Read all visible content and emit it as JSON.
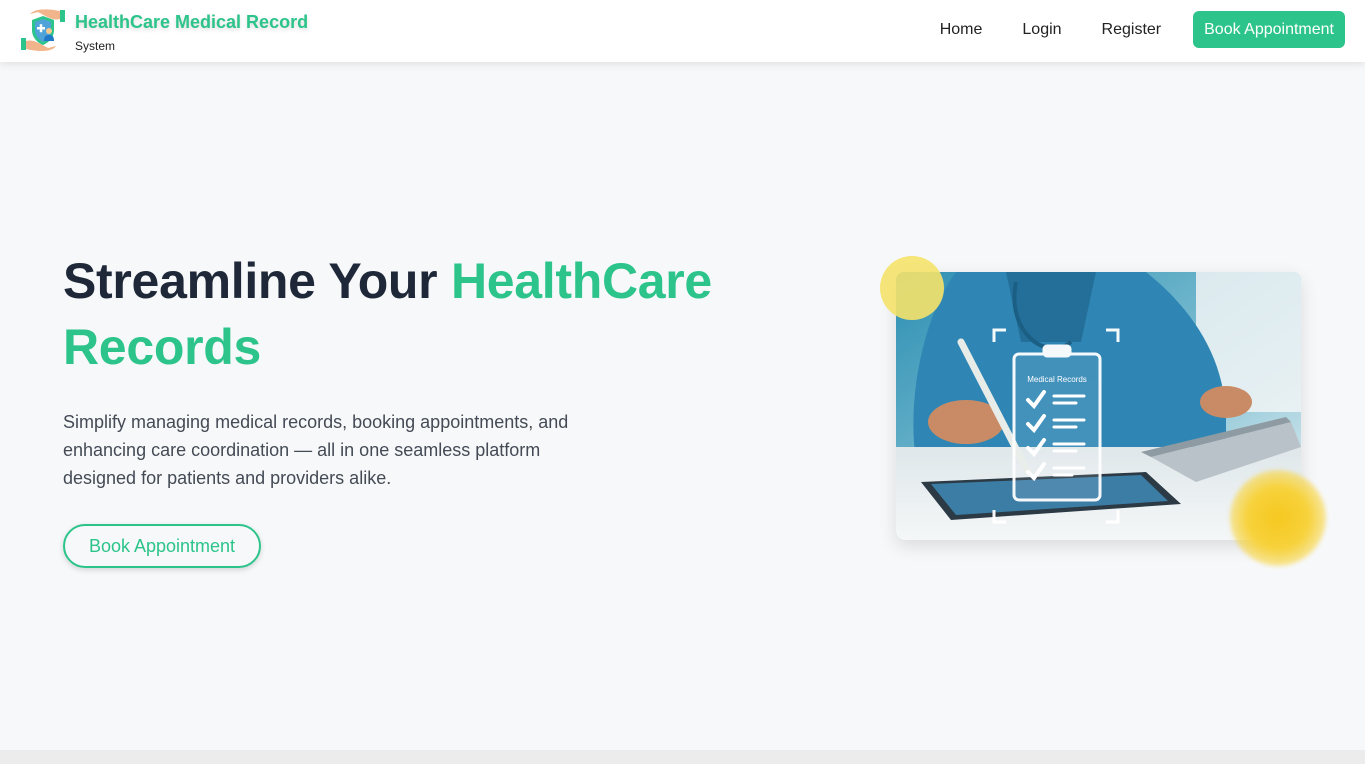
{
  "brand": {
    "title": "HealthCare Medical Record",
    "subtitle": "System",
    "logo_icon": "medical-shield-hands-icon"
  },
  "nav": {
    "links": [
      "Home",
      "Login",
      "Register"
    ],
    "cta": "Book Appointment"
  },
  "hero": {
    "title_part1": "Streamline Your ",
    "title_accent": "HealthCare",
    "title_part2": "Records",
    "description": "Simplify managing medical records, booking appointments, and enhancing care coordination — all in one seamless platform designed for patients and providers alike.",
    "button": "Book Appointment",
    "image_caption": "Medical Records"
  },
  "colors": {
    "accent": "#2cc48a",
    "dark_text": "#1e2838",
    "yellow_dot": "#f5e26a",
    "glow_dot": "#f6c820",
    "background": "#f7f8fa"
  }
}
